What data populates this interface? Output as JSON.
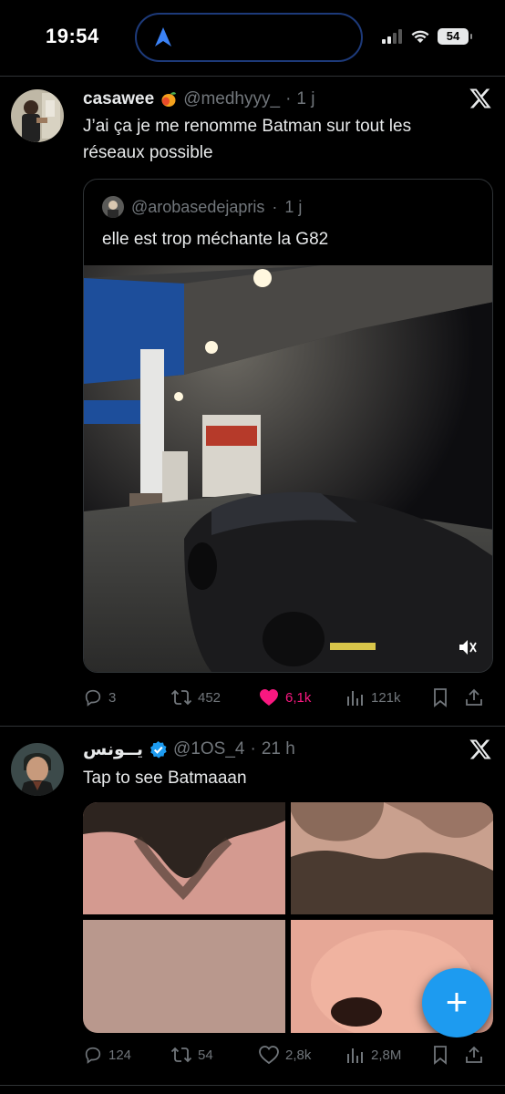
{
  "status_bar": {
    "time": "19:54",
    "battery": "54",
    "icons": [
      "location-arrow-icon",
      "signal-icon",
      "wifi-icon",
      "battery-icon"
    ]
  },
  "tweets": [
    {
      "author_name": "casawee",
      "author_emoji": "mango-emoji",
      "handle": "@medhyyy_",
      "separator": "·",
      "time_ago": "1 j",
      "text_line1": "J’ai ça je me renomme Batman sur tout les",
      "text_line2": "réseaux possible",
      "quote": {
        "handle": "@arobasedejapris",
        "separator": "·",
        "time_ago": "1 j",
        "text": "elle est trop méchante la G82"
      },
      "actions": {
        "replies": "3",
        "retweets": "452",
        "likes": "6,1k",
        "views": "121k"
      }
    },
    {
      "author_name": "يــونس",
      "verified": true,
      "handle": "@1OS_4",
      "separator": "·",
      "time_ago": "21 h",
      "text": "Tap to see Batmaaan",
      "actions": {
        "replies": "124",
        "retweets": "54",
        "likes": "2,8k",
        "views": "2,8M"
      }
    }
  ],
  "fab_label": "+",
  "colors": {
    "background": "#000000",
    "text": "#e7e9ea",
    "muted": "#71767b",
    "like": "#f91880",
    "accent": "#1d9bf0",
    "divider": "#2f3336"
  }
}
